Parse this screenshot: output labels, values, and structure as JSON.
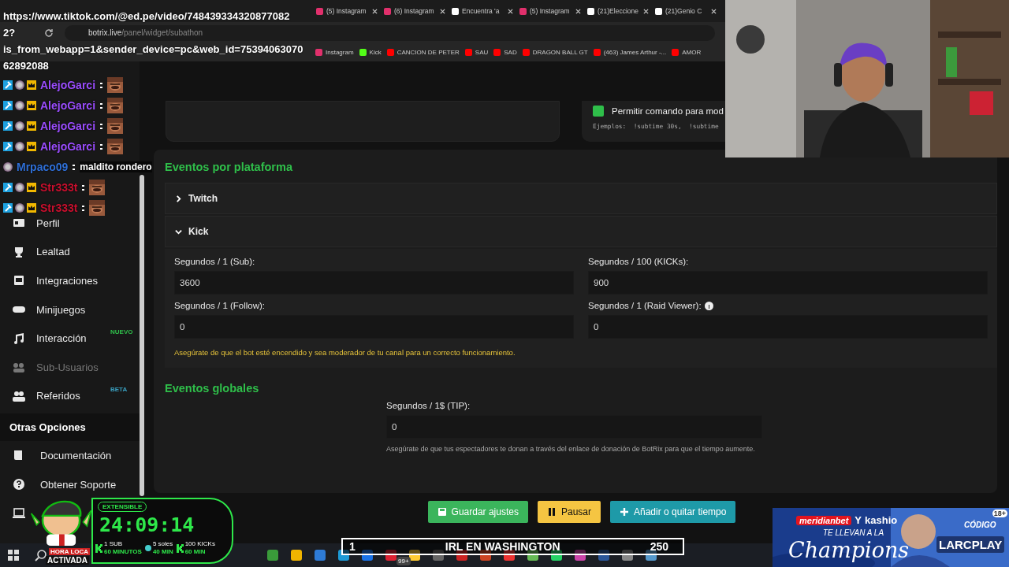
{
  "browser": {
    "tabs": [
      {
        "title": "(5) Instagram",
        "kind": "instagram"
      },
      {
        "title": "(6) Instagram",
        "kind": "instagram"
      },
      {
        "title": "Encuentra 'a",
        "kind": "tiktok"
      },
      {
        "title": "(5) Instagram",
        "kind": "instagram"
      },
      {
        "title": "(21)Eleccione",
        "kind": "tiktok"
      },
      {
        "title": "(21)Genio C",
        "kind": "tiktok"
      }
    ],
    "address_host": "botrix.live",
    "address_path": "/panel/widget/subathon",
    "bookmarks": [
      {
        "title": "Instagram",
        "kind": "instagram"
      },
      {
        "title": "Kick",
        "kind": "kick"
      },
      {
        "title": "CANCION DE PETER",
        "kind": "youtube"
      },
      {
        "title": "SAU",
        "kind": "youtube"
      },
      {
        "title": "SAD",
        "kind": "youtube"
      },
      {
        "title": "DRAGON BALL GT",
        "kind": "youtube"
      },
      {
        "title": "(463) James Arthur -...",
        "kind": "youtube"
      },
      {
        "title": "AMOR",
        "kind": "youtube"
      }
    ]
  },
  "sidebar": {
    "items": [
      {
        "label": "Perfil",
        "kind": "profile",
        "disabled": false
      },
      {
        "label": "Lealtad",
        "kind": "trophy",
        "disabled": false
      },
      {
        "label": "Integraciones",
        "kind": "integration",
        "disabled": false
      },
      {
        "label": "Minijuegos",
        "kind": "gamepad",
        "disabled": false
      },
      {
        "label": "Interacción",
        "kind": "music",
        "disabled": false,
        "badge": {
          "text": "NUEVO",
          "kind": "new"
        }
      },
      {
        "label": "Sub-Usuarios",
        "kind": "users",
        "disabled": true
      },
      {
        "label": "Referidos",
        "kind": "referral",
        "disabled": false,
        "badge": {
          "text": "BETA",
          "kind": "beta"
        }
      }
    ],
    "section": "Otras Opciones",
    "other_items": [
      {
        "label": "Documentación",
        "kind": "doc"
      },
      {
        "label": "Obtener Soporte",
        "kind": "help"
      },
      {
        "kind": "laptop"
      }
    ]
  },
  "top_card": {
    "checkbox": {
      "label": "Permitir comando para mod",
      "checked": true
    },
    "examples": "Ejemplos:  !subtime 30s,  !subtime"
  },
  "platform_events": {
    "title": "Eventos por plataforma",
    "accordions": [
      {
        "label": "Twitch",
        "expanded": false
      },
      {
        "label": "Kick",
        "expanded": true
      }
    ],
    "fields": [
      {
        "label": "Segundos / 1 (Sub):",
        "value": "3600",
        "info": false
      },
      {
        "label": "Segundos / 100 (KICKs):",
        "value": "900",
        "info": false
      },
      {
        "label": "Segundos / 1 (Follow):",
        "value": "0",
        "info": false
      },
      {
        "label": "Segundos / 1 (Raid Viewer):",
        "value": "0",
        "info": true
      }
    ],
    "warning": "Asegúrate de que el bot esté encendido y sea moderador de tu canal para un correcto funcionamiento."
  },
  "global_events": {
    "title": "Eventos globales",
    "field": {
      "label": "Segundos / 1$ (TIP):",
      "value": "0"
    },
    "hint": "Asegúrate de que tus espectadores te donan a través del enlace de donación de BotRix para que el tiempo aumente."
  },
  "buttons": [
    {
      "label": "Guardar ajustes",
      "kind": "save"
    },
    {
      "label": "Pausar",
      "kind": "pause"
    },
    {
      "label": "Añadir o quitar tiempo",
      "kind": "add"
    }
  ],
  "overlay": {
    "url_lines": [
      "https://www.tiktok.com/@ed.pe/video/748439334320877082",
      "2?",
      "is_from_webapp=1&sender_device=pc&web_id=75394063070",
      "62892088"
    ],
    "chat": [
      {
        "user": "AlejoGarci",
        "color": "#9b4dff",
        "badges": true
      },
      {
        "user": "AlejoGarci",
        "color": "#9b4dff",
        "badges": true
      },
      {
        "user": "AlejoGarci",
        "color": "#9b4dff",
        "badges": true
      },
      {
        "user": "AlejoGarci",
        "color": "#9b4dff",
        "badges": true
      },
      {
        "user": "Mrpaco09",
        "color": "#2f6fd6",
        "badges": false,
        "message": "maldito rondero"
      },
      {
        "user": "Str333t",
        "color": "#c8102e",
        "badges": true
      },
      {
        "user": "Str333t",
        "color": "#c8102e",
        "badges": true
      }
    ],
    "timer": {
      "badge": "EXTENSIBLE",
      "time": "24:09:14",
      "mascot_top": "HORA LOCA",
      "mascot_bottom": "ACTIVADA",
      "stats": [
        {
          "top": "1 SUB",
          "bottom": "60 MINUTOS",
          "kind": "kick"
        },
        {
          "top": "5 soles",
          "bottom": "40 MIN",
          "kind": "coin"
        },
        {
          "top": "100 KICKs",
          "bottom": "60 MIN",
          "kind": "kick"
        }
      ]
    },
    "banner": {
      "rank": "1",
      "title": "IRL EN WASHINGTON",
      "score": "250"
    },
    "ad": {
      "brand": "meridianbet",
      "joiner": "Y",
      "partner": "kashio",
      "line": "TE LLEVAN A LA",
      "headline": "Champions",
      "code_label": "CÓDIGO",
      "code": "LARCPLAY",
      "age": "18+"
    }
  },
  "taskbar": {
    "badge": "99+"
  }
}
